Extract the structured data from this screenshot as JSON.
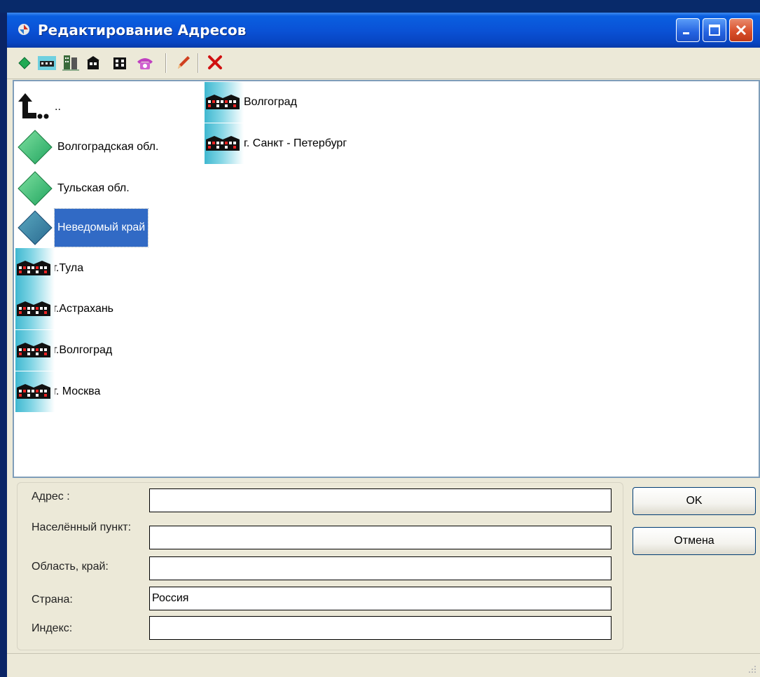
{
  "window": {
    "title": "Редактирование Адресов"
  },
  "toolbar": {
    "buttons": [
      "region-icon",
      "city-icon",
      "street-icon",
      "house-icon",
      "building-icon",
      "phone-icon",
      "edit-icon",
      "delete-icon"
    ]
  },
  "list": {
    "up_label": "..",
    "items": [
      {
        "type": "region",
        "label": "Волгоградская обл."
      },
      {
        "type": "region",
        "label": "Тульская обл."
      },
      {
        "type": "region",
        "label": "Неведомый край",
        "selected": true
      },
      {
        "type": "city",
        "label": "г.Тула"
      },
      {
        "type": "city",
        "label": "г.Астрахань"
      },
      {
        "type": "city",
        "label": "г.Волгоград"
      },
      {
        "type": "city",
        "label": "г. Москва"
      },
      {
        "type": "city",
        "label": "Волгоград"
      },
      {
        "type": "city",
        "label": "г. Санкт - Петербург"
      }
    ]
  },
  "form": {
    "address": {
      "label": "Адрес :",
      "value": ""
    },
    "locality": {
      "label": "Населённый пункт:",
      "value": ""
    },
    "region": {
      "label": "Область, край:",
      "value": ""
    },
    "country": {
      "label": "Страна:",
      "value": "Россия"
    },
    "index": {
      "label": "Индекс:",
      "value": ""
    }
  },
  "buttons": {
    "ok": "OK",
    "cancel": "Отмена"
  },
  "colors": {
    "title_bar": "#0a52d6",
    "selection": "#316ac5",
    "region_diamond": "#3cb371"
  }
}
